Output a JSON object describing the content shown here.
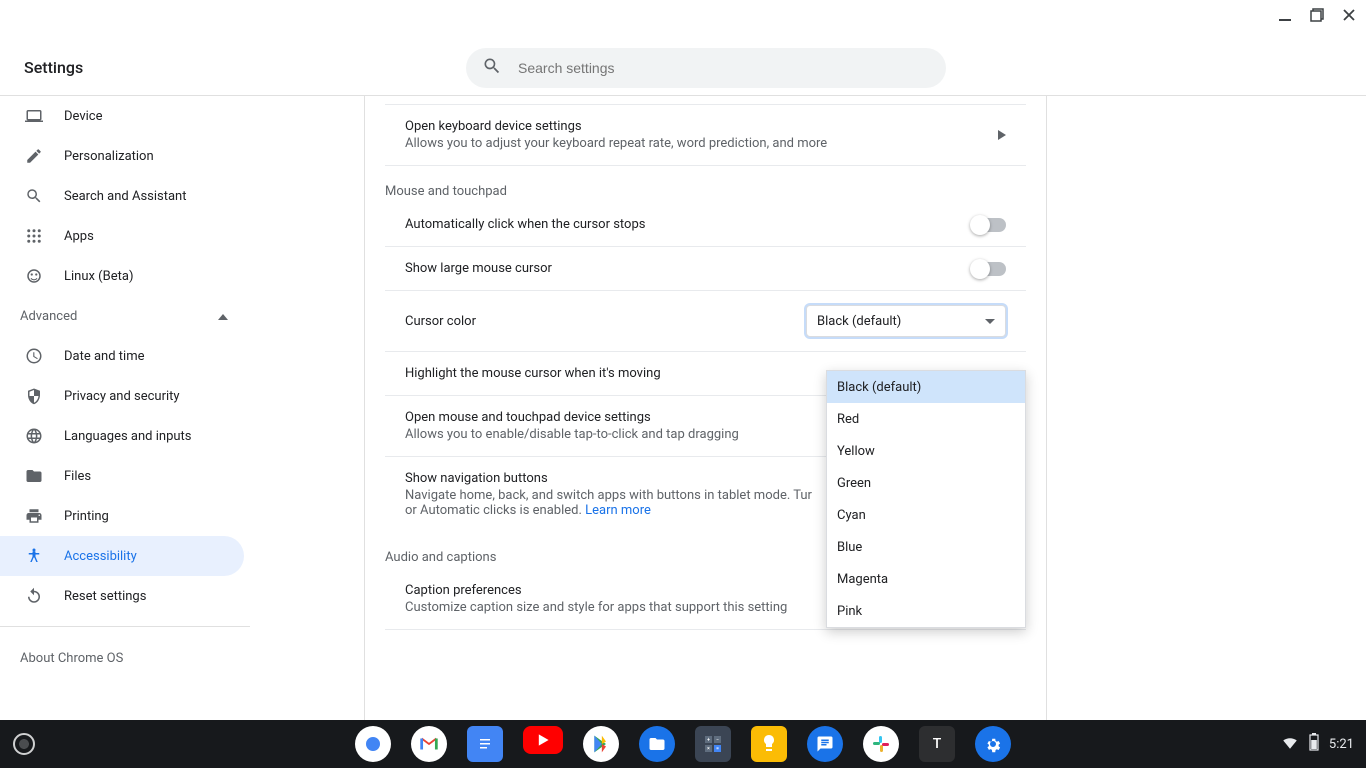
{
  "header": {
    "title": "Settings",
    "search_placeholder": "Search settings"
  },
  "sidebar": {
    "top": [
      {
        "label": "Device"
      },
      {
        "label": "Personalization"
      },
      {
        "label": "Search and Assistant"
      },
      {
        "label": "Apps"
      },
      {
        "label": "Linux (Beta)"
      }
    ],
    "advanced_label": "Advanced",
    "advanced": [
      {
        "label": "Date and time"
      },
      {
        "label": "Privacy and security"
      },
      {
        "label": "Languages and inputs"
      },
      {
        "label": "Files"
      },
      {
        "label": "Printing"
      },
      {
        "label": "Accessibility"
      },
      {
        "label": "Reset settings"
      }
    ],
    "about": "About Chrome OS"
  },
  "main": {
    "keyboard": {
      "title": "Open keyboard device settings",
      "sub": "Allows you to adjust your keyboard repeat rate, word prediction, and more"
    },
    "sec_mouse": "Mouse and touchpad",
    "auto_click": "Automatically click when the cursor stops",
    "large_cursor": "Show large mouse cursor",
    "cursor_color_label": "Cursor color",
    "cursor_color_value": "Black (default)",
    "cursor_color_options": [
      "Black (default)",
      "Red",
      "Yellow",
      "Green",
      "Cyan",
      "Blue",
      "Magenta",
      "Pink"
    ],
    "highlight_cursor": "Highlight the mouse cursor when it's moving",
    "mouse_settings": {
      "title": "Open mouse and touchpad device settings",
      "sub": "Allows you to enable/disable tap-to-click and tap dragging"
    },
    "nav_buttons": {
      "title": "Show navigation buttons",
      "sub_a": "Navigate home, back, and switch apps with buttons in tablet mode. Tur",
      "sub_b": "or Automatic clicks is enabled.  ",
      "learn": "Learn more"
    },
    "sec_audio": "Audio and captions",
    "captions": {
      "title": "Caption preferences",
      "sub": "Customize caption size and style for apps that support this setting"
    }
  },
  "shelf": {
    "clock": "5:21",
    "apps": [
      "chrome",
      "gmail",
      "docs",
      "youtube",
      "play",
      "files",
      "calc",
      "keep",
      "messages",
      "slack",
      "terminal",
      "settings"
    ]
  }
}
